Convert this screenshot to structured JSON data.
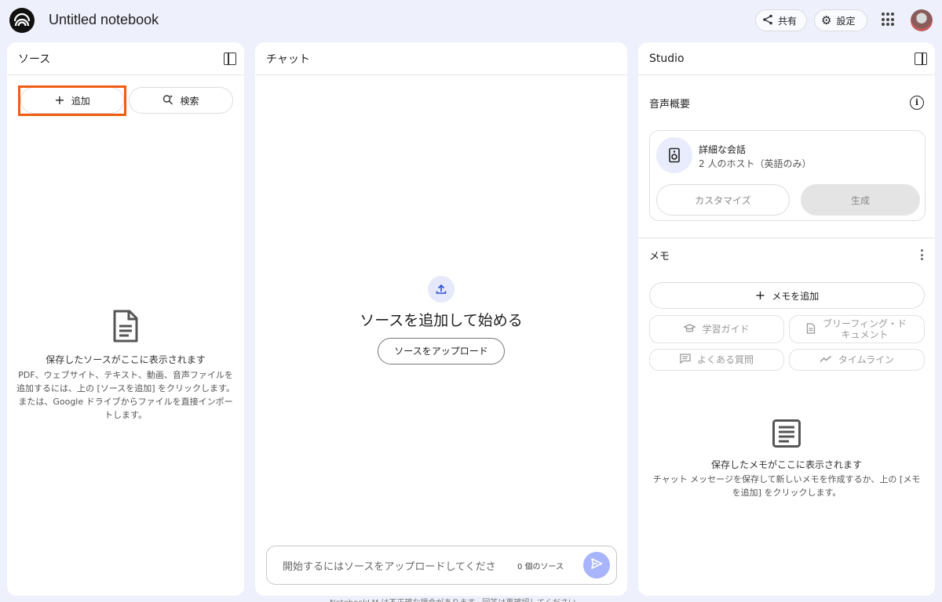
{
  "header": {
    "notebook_title": "Untitled notebook",
    "share_label": "共有",
    "settings_label": "設定"
  },
  "sources": {
    "title": "ソース",
    "add_label": "追加",
    "search_label": "検索",
    "empty_title": "保存したソースがここに表示されます",
    "empty_desc": "PDF、ウェブサイト、テキスト、動画、音声ファイルを追加するには、上の [ソースを追加] をクリックします。または、Google ドライブからファイルを直接インポートします。"
  },
  "chat": {
    "title": "チャット",
    "headline": "ソースを追加して始める",
    "upload_label": "ソースをアップロード",
    "input_placeholder": "開始するにはソースをアップロードしてくださ",
    "source_count": "0 個のソース",
    "footer_note": "NotebookLM は不正確な場合があります。回答は再確認してください。"
  },
  "studio": {
    "title": "Studio",
    "audio_overview": "音声概要",
    "audio_card_title": "詳細な会話",
    "audio_card_sub": "2 人のホスト（英語のみ）",
    "customize_label": "カスタマイズ",
    "generate_label": "生成",
    "memo_title": "メモ",
    "add_memo_label": "メモを追加",
    "chips": {
      "study_guide": "学習ガイド",
      "briefing_doc": "ブリーフィング・ドキュメント",
      "faq": "よくある質問",
      "timeline": "タイムライン"
    },
    "empty_title": "保存したメモがここに表示されます",
    "empty_desc": "チャット メッセージを保存して新しいメモを作成するか、上の [メモを追加] をクリックします。"
  },
  "colors": {
    "background": "#eef0fb",
    "highlight": "#f35d10",
    "send_button": "#a8b4fb"
  }
}
